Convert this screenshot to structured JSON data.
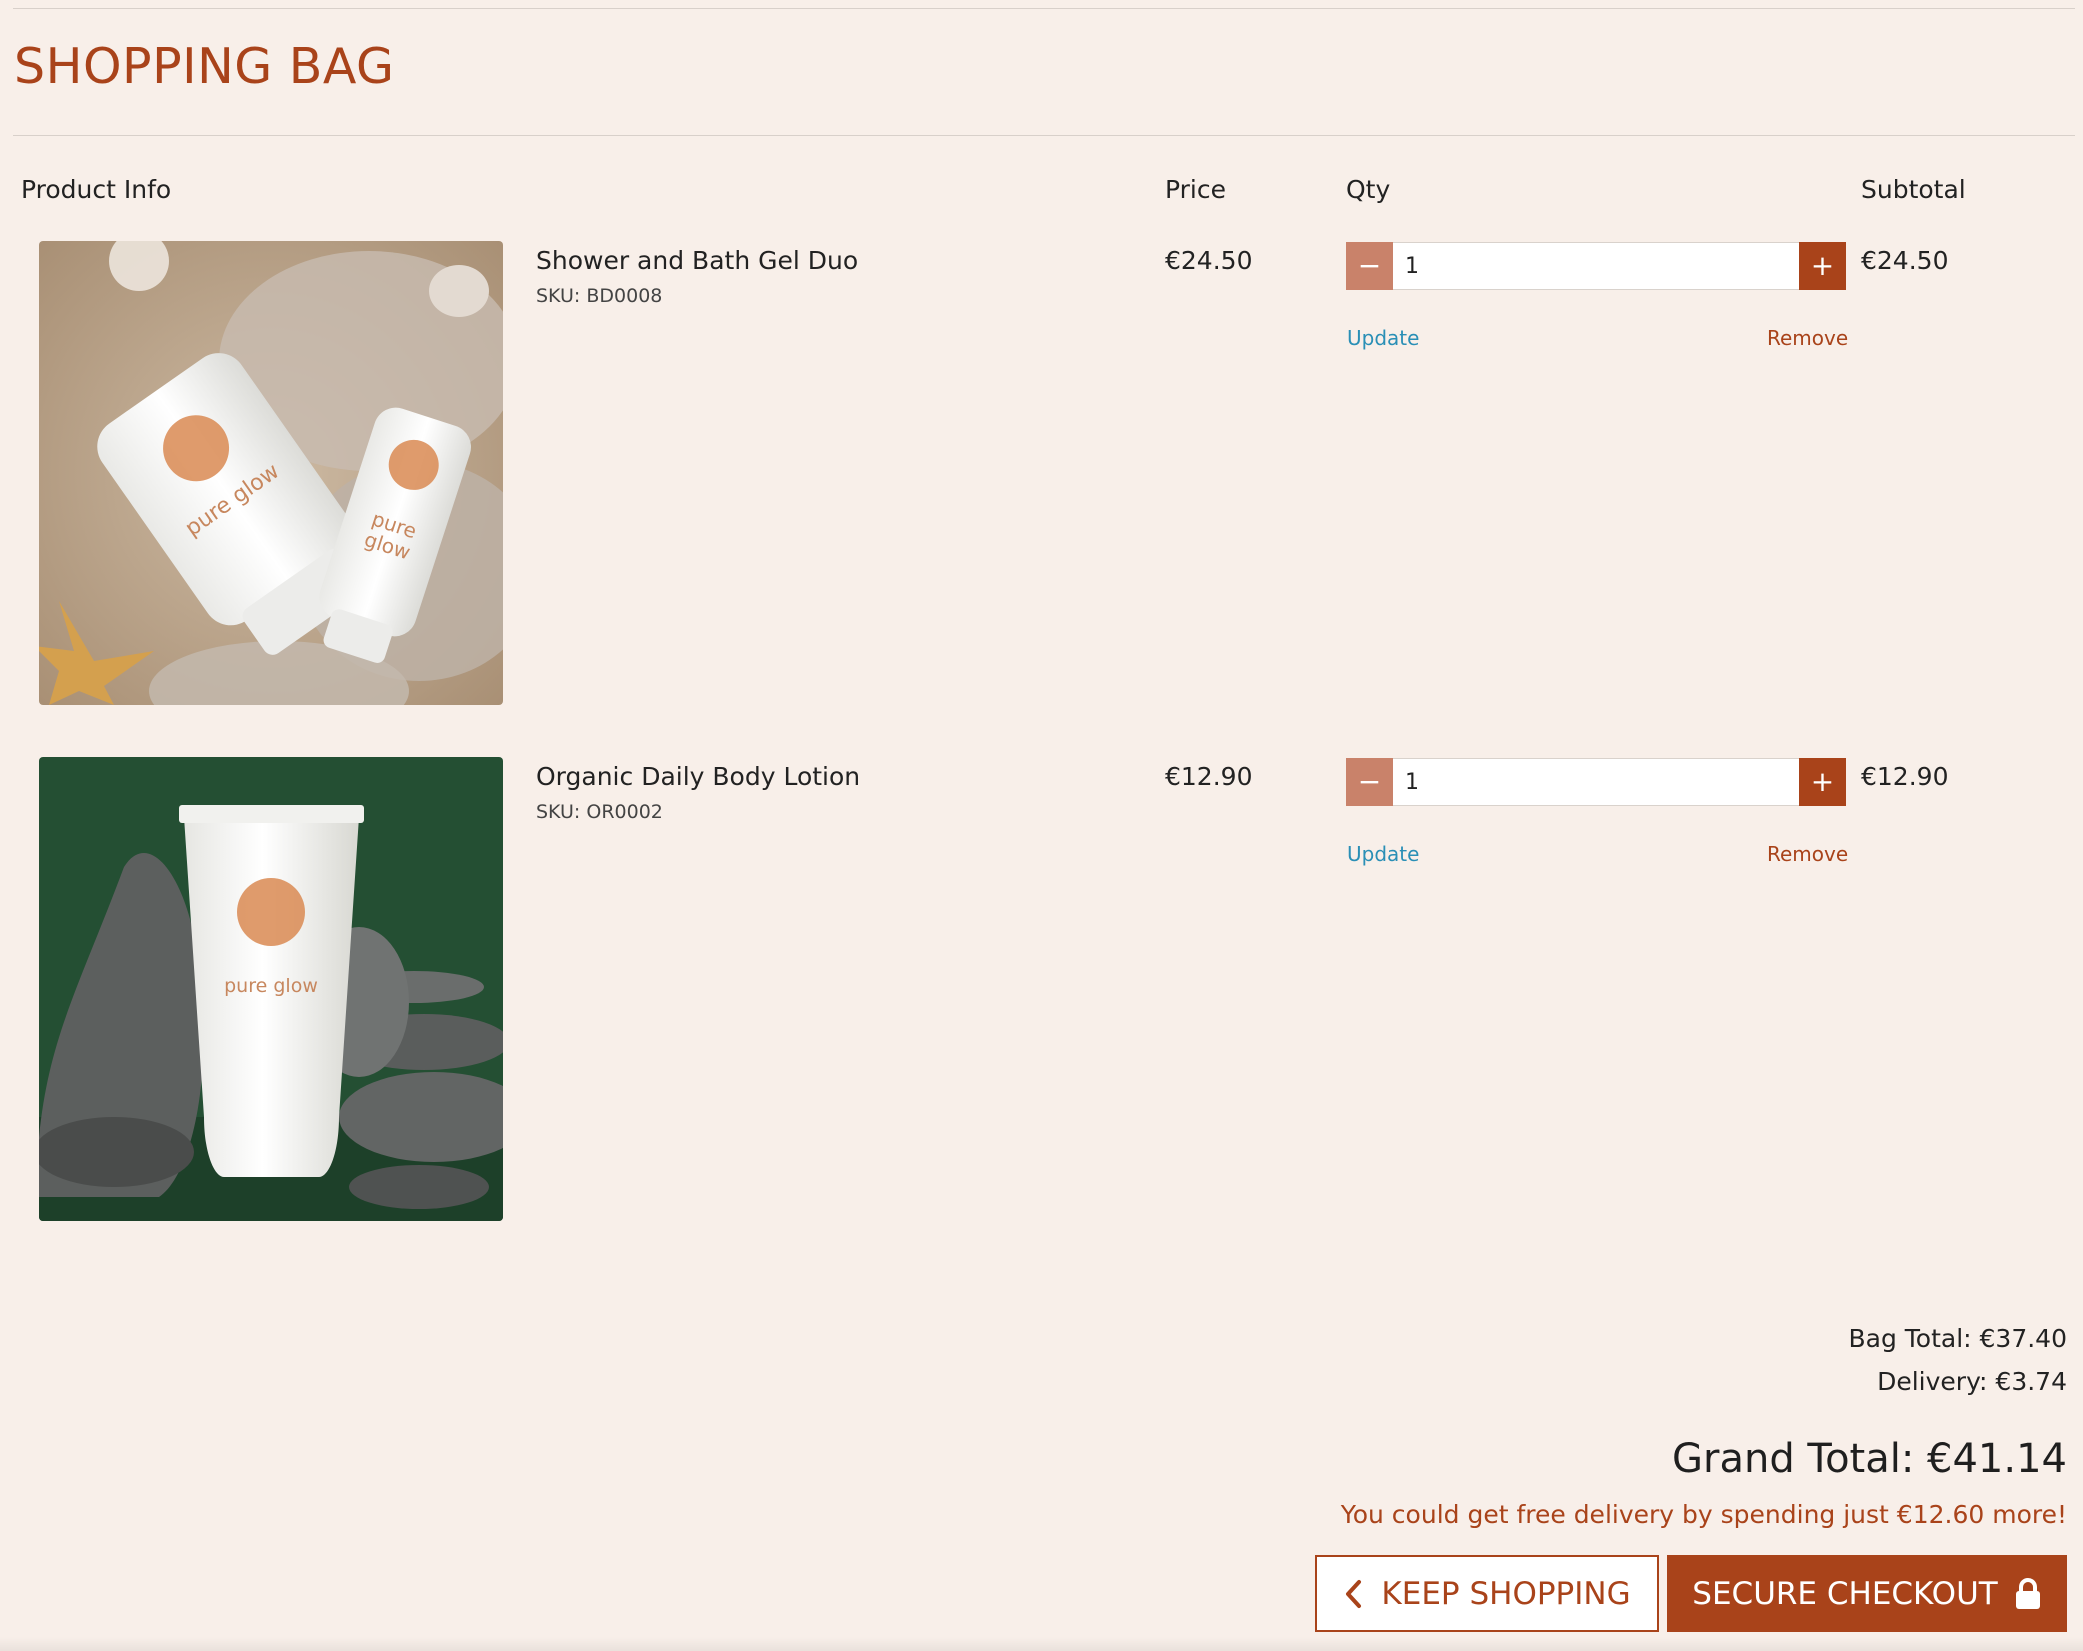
{
  "page": {
    "title": "SHOPPING BAG"
  },
  "columns": {
    "product_info": "Product Info",
    "price": "Price",
    "qty": "Qty",
    "subtotal": "Subtotal"
  },
  "items": [
    {
      "name": "Shower and Bath Gel Duo",
      "sku": "SKU: BD0008",
      "price": "€24.50",
      "qty": "1",
      "subtotal": "€24.50",
      "update_label": "Update",
      "remove_label": "Remove",
      "image_brand_text": "pure glow"
    },
    {
      "name": "Organic Daily Body Lotion",
      "sku": "SKU: OR0002",
      "price": "€12.90",
      "qty": "1",
      "subtotal": "€12.90",
      "update_label": "Update",
      "remove_label": "Remove",
      "image_brand_text": "pure glow"
    }
  ],
  "qty_controls": {
    "minus_icon": "minus-icon",
    "plus_icon": "plus-icon"
  },
  "summary": {
    "bag_total": "Bag Total: €37.40",
    "delivery": "Delivery: €3.74",
    "grand_total": "Grand Total: €41.14",
    "free_delivery_message": "You could get free delivery by spending just €12.60 more!"
  },
  "actions": {
    "keep_shopping": "KEEP SHOPPING",
    "keep_shopping_icon": "chevron-left-icon",
    "secure_checkout": "SECURE CHECKOUT",
    "secure_checkout_icon": "lock-icon"
  },
  "colors": {
    "background": "#f8efe9",
    "brand": "#a9431a",
    "brand_light": "#c9826a",
    "link": "#2a8fb6"
  }
}
